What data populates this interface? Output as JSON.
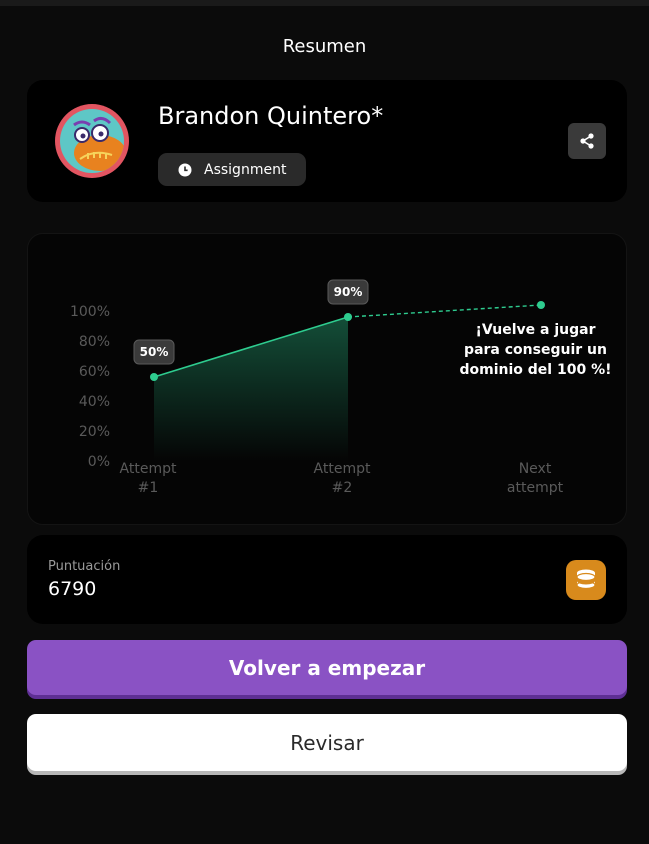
{
  "header": {
    "title": "Resumen"
  },
  "profile": {
    "name": "Brandon Quintero*",
    "tag_label": "Assignment",
    "avatar_icon": "monster-avatar-icon",
    "share_icon": "share-icon"
  },
  "chart_data": {
    "type": "line",
    "categories": [
      "Attempt #1",
      "Attempt #2",
      "Next attempt"
    ],
    "category_lines": [
      [
        "Attempt",
        "#1"
      ],
      [
        "Attempt",
        "#2"
      ],
      [
        "Next",
        "attempt"
      ]
    ],
    "values": [
      56,
      96,
      104
    ],
    "data_labels": [
      "50%",
      "90%",
      null
    ],
    "ytick_labels": [
      "100%",
      "80%",
      "60%",
      "40%",
      "20%",
      "0%"
    ],
    "ytick_values": [
      100,
      80,
      60,
      40,
      20,
      0
    ],
    "ylim": [
      0,
      100
    ],
    "projected_from_index": 1,
    "color": "#2ecc8f",
    "label_bg": "#3a3a3a"
  },
  "chart_note": {
    "line1": "¡Vuelve a jugar",
    "line2": "para conseguir un",
    "line3": "dominio del 100 %!"
  },
  "score": {
    "label": "Puntuación",
    "value": "6790",
    "icon": "coins-icon",
    "icon_color": "#d88a1c"
  },
  "actions": {
    "restart_label": "Volver a empezar",
    "review_label": "Revisar"
  },
  "colors": {
    "primary": "#8a52c4",
    "background": "#0b0b0b",
    "card": "#000000"
  }
}
